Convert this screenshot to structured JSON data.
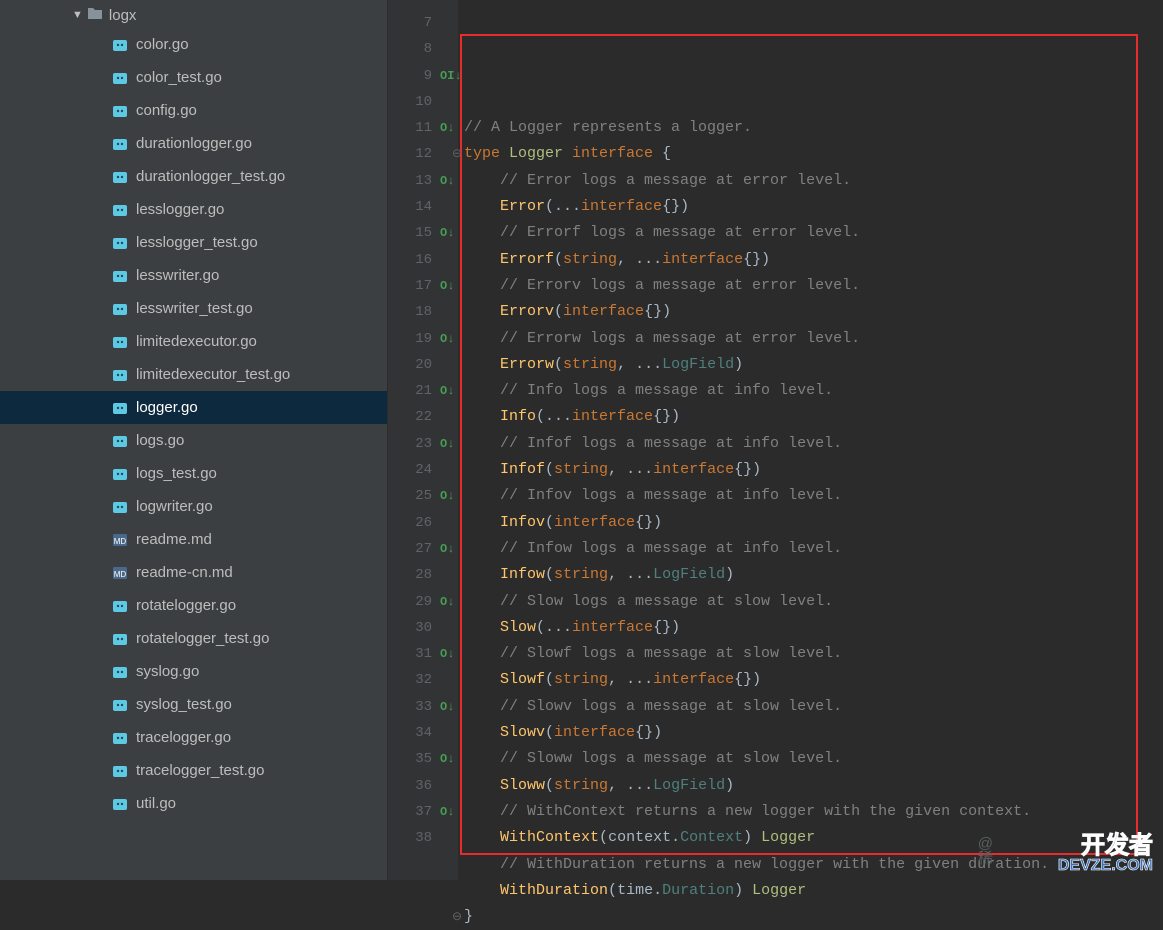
{
  "sidebar": {
    "folder": {
      "name": "logx"
    },
    "files": [
      {
        "name": "color.go",
        "icon": "go"
      },
      {
        "name": "color_test.go",
        "icon": "go"
      },
      {
        "name": "config.go",
        "icon": "go"
      },
      {
        "name": "durationlogger.go",
        "icon": "go"
      },
      {
        "name": "durationlogger_test.go",
        "icon": "go"
      },
      {
        "name": "lesslogger.go",
        "icon": "go"
      },
      {
        "name": "lesslogger_test.go",
        "icon": "go"
      },
      {
        "name": "lesswriter.go",
        "icon": "go"
      },
      {
        "name": "lesswriter_test.go",
        "icon": "go"
      },
      {
        "name": "limitedexecutor.go",
        "icon": "go"
      },
      {
        "name": "limitedexecutor_test.go",
        "icon": "go"
      },
      {
        "name": "logger.go",
        "icon": "go",
        "selected": true
      },
      {
        "name": "logs.go",
        "icon": "go"
      },
      {
        "name": "logs_test.go",
        "icon": "go"
      },
      {
        "name": "logwriter.go",
        "icon": "go"
      },
      {
        "name": "readme.md",
        "icon": "md"
      },
      {
        "name": "readme-cn.md",
        "icon": "md"
      },
      {
        "name": "rotatelogger.go",
        "icon": "go"
      },
      {
        "name": "rotatelogger_test.go",
        "icon": "go"
      },
      {
        "name": "syslog.go",
        "icon": "go"
      },
      {
        "name": "syslog_test.go",
        "icon": "go"
      },
      {
        "name": "tracelogger.go",
        "icon": "go"
      },
      {
        "name": "tracelogger_test.go",
        "icon": "go"
      },
      {
        "name": "util.go",
        "icon": "go"
      }
    ]
  },
  "editor": {
    "gutter_start": 7,
    "lines": [
      {
        "n": 7,
        "mark": "",
        "tokens": []
      },
      {
        "n": 8,
        "mark": "",
        "tokens": [
          [
            "comment",
            "// A Logger represents a logger."
          ]
        ]
      },
      {
        "n": 9,
        "mark": "OI↓",
        "fold": true,
        "tokens": [
          [
            "keyword",
            "type "
          ],
          [
            "type",
            "Logger "
          ],
          [
            "keyword",
            "interface "
          ],
          [
            "brace",
            "{"
          ]
        ]
      },
      {
        "n": 10,
        "mark": "",
        "tokens": [
          [
            "indent",
            "    "
          ],
          [
            "comment",
            "// Error logs a message at error level."
          ]
        ]
      },
      {
        "n": 11,
        "mark": "O↓",
        "tokens": [
          [
            "indent",
            "    "
          ],
          [
            "func",
            "Error"
          ],
          [
            "brace",
            "(..."
          ],
          [
            "keyword",
            "interface"
          ],
          [
            "brace",
            "{})"
          ]
        ]
      },
      {
        "n": 12,
        "mark": "",
        "tokens": [
          [
            "indent",
            "    "
          ],
          [
            "comment",
            "// Errorf logs a message at error level."
          ]
        ]
      },
      {
        "n": 13,
        "mark": "O↓",
        "tokens": [
          [
            "indent",
            "    "
          ],
          [
            "func",
            "Errorf"
          ],
          [
            "brace",
            "("
          ],
          [
            "keyword",
            "string"
          ],
          [
            "ident",
            ", "
          ],
          [
            "brace",
            "..."
          ],
          [
            "keyword",
            "interface"
          ],
          [
            "brace",
            "{})"
          ]
        ]
      },
      {
        "n": 14,
        "mark": "",
        "tokens": [
          [
            "indent",
            "    "
          ],
          [
            "comment",
            "// Errorv logs a message at error level."
          ]
        ]
      },
      {
        "n": 15,
        "mark": "O↓",
        "tokens": [
          [
            "indent",
            "    "
          ],
          [
            "func",
            "Errorv"
          ],
          [
            "brace",
            "("
          ],
          [
            "keyword",
            "interface"
          ],
          [
            "brace",
            "{})"
          ]
        ]
      },
      {
        "n": 16,
        "mark": "",
        "tokens": [
          [
            "indent",
            "    "
          ],
          [
            "comment",
            "// Errorw logs a message at error level."
          ]
        ]
      },
      {
        "n": 17,
        "mark": "O↓",
        "tokens": [
          [
            "indent",
            "    "
          ],
          [
            "func",
            "Errorw"
          ],
          [
            "brace",
            "("
          ],
          [
            "keyword",
            "string"
          ],
          [
            "ident",
            ", "
          ],
          [
            "brace",
            "..."
          ],
          [
            "lf",
            "LogField"
          ],
          [
            "brace",
            ")"
          ]
        ]
      },
      {
        "n": 18,
        "mark": "",
        "tokens": [
          [
            "indent",
            "    "
          ],
          [
            "comment",
            "// Info logs a message at info level."
          ]
        ]
      },
      {
        "n": 19,
        "mark": "O↓",
        "tokens": [
          [
            "indent",
            "    "
          ],
          [
            "func",
            "Info"
          ],
          [
            "brace",
            "(..."
          ],
          [
            "keyword",
            "interface"
          ],
          [
            "brace",
            "{})"
          ]
        ]
      },
      {
        "n": 20,
        "mark": "",
        "tokens": [
          [
            "indent",
            "    "
          ],
          [
            "comment",
            "// Infof logs a message at info level."
          ]
        ]
      },
      {
        "n": 21,
        "mark": "O↓",
        "tokens": [
          [
            "indent",
            "    "
          ],
          [
            "func",
            "Infof"
          ],
          [
            "brace",
            "("
          ],
          [
            "keyword",
            "string"
          ],
          [
            "ident",
            ", "
          ],
          [
            "brace",
            "..."
          ],
          [
            "keyword",
            "interface"
          ],
          [
            "brace",
            "{})"
          ]
        ]
      },
      {
        "n": 22,
        "mark": "",
        "tokens": [
          [
            "indent",
            "    "
          ],
          [
            "comment",
            "// Infov logs a message at info level."
          ]
        ]
      },
      {
        "n": 23,
        "mark": "O↓",
        "tokens": [
          [
            "indent",
            "    "
          ],
          [
            "func",
            "Infov"
          ],
          [
            "brace",
            "("
          ],
          [
            "keyword",
            "interface"
          ],
          [
            "brace",
            "{})"
          ]
        ]
      },
      {
        "n": 24,
        "mark": "",
        "tokens": [
          [
            "indent",
            "    "
          ],
          [
            "comment",
            "// Infow logs a message at info level."
          ]
        ]
      },
      {
        "n": 25,
        "mark": "O↓",
        "tokens": [
          [
            "indent",
            "    "
          ],
          [
            "func",
            "Infow"
          ],
          [
            "brace",
            "("
          ],
          [
            "keyword",
            "string"
          ],
          [
            "ident",
            ", "
          ],
          [
            "brace",
            "..."
          ],
          [
            "lf",
            "LogField"
          ],
          [
            "brace",
            ")"
          ]
        ]
      },
      {
        "n": 26,
        "mark": "",
        "tokens": [
          [
            "indent",
            "    "
          ],
          [
            "comment",
            "// Slow logs a message at slow level."
          ]
        ]
      },
      {
        "n": 27,
        "mark": "O↓",
        "tokens": [
          [
            "indent",
            "    "
          ],
          [
            "func",
            "Slow"
          ],
          [
            "brace",
            "(..."
          ],
          [
            "keyword",
            "interface"
          ],
          [
            "brace",
            "{})"
          ]
        ]
      },
      {
        "n": 28,
        "mark": "",
        "tokens": [
          [
            "indent",
            "    "
          ],
          [
            "comment",
            "// Slowf logs a message at slow level."
          ]
        ]
      },
      {
        "n": 29,
        "mark": "O↓",
        "tokens": [
          [
            "indent",
            "    "
          ],
          [
            "func",
            "Slowf"
          ],
          [
            "brace",
            "("
          ],
          [
            "keyword",
            "string"
          ],
          [
            "ident",
            ", "
          ],
          [
            "brace",
            "..."
          ],
          [
            "keyword",
            "interface"
          ],
          [
            "brace",
            "{})"
          ]
        ]
      },
      {
        "n": 30,
        "mark": "",
        "tokens": [
          [
            "indent",
            "    "
          ],
          [
            "comment",
            "// Slowv logs a message at slow level."
          ]
        ]
      },
      {
        "n": 31,
        "mark": "O↓",
        "tokens": [
          [
            "indent",
            "    "
          ],
          [
            "func",
            "Slowv"
          ],
          [
            "brace",
            "("
          ],
          [
            "keyword",
            "interface"
          ],
          [
            "brace",
            "{})"
          ]
        ]
      },
      {
        "n": 32,
        "mark": "",
        "tokens": [
          [
            "indent",
            "    "
          ],
          [
            "comment",
            "// Sloww logs a message at slow level."
          ]
        ]
      },
      {
        "n": 33,
        "mark": "O↓",
        "tokens": [
          [
            "indent",
            "    "
          ],
          [
            "func",
            "Sloww"
          ],
          [
            "brace",
            "("
          ],
          [
            "keyword",
            "string"
          ],
          [
            "ident",
            ", "
          ],
          [
            "brace",
            "..."
          ],
          [
            "lf",
            "LogField"
          ],
          [
            "brace",
            ")"
          ]
        ]
      },
      {
        "n": 34,
        "mark": "",
        "tokens": [
          [
            "indent",
            "    "
          ],
          [
            "comment",
            "// WithContext returns a new logger with the given context."
          ]
        ]
      },
      {
        "n": 35,
        "mark": "O↓",
        "tokens": [
          [
            "indent",
            "    "
          ],
          [
            "func",
            "WithContext"
          ],
          [
            "brace",
            "("
          ],
          [
            "ident",
            "context."
          ],
          [
            "lf",
            "Context"
          ],
          [
            "brace",
            ") "
          ],
          [
            "type",
            "Logger"
          ]
        ]
      },
      {
        "n": 36,
        "mark": "",
        "tokens": [
          [
            "indent",
            "    "
          ],
          [
            "comment",
            "// WithDuration returns a new logger with the given duration."
          ]
        ]
      },
      {
        "n": 37,
        "mark": "O↓",
        "tokens": [
          [
            "indent",
            "    "
          ],
          [
            "func",
            "WithDuration"
          ],
          [
            "brace",
            "("
          ],
          [
            "ident",
            "time."
          ],
          [
            "lf",
            "Duration"
          ],
          [
            "brace",
            ") "
          ],
          [
            "type",
            "Logger"
          ]
        ]
      },
      {
        "n": 38,
        "mark": "",
        "foldend": true,
        "tokens": [
          [
            "brace",
            "}"
          ]
        ]
      }
    ]
  },
  "watermark": {
    "l1": "开发者",
    "l2": "DEVZE.COM",
    "faint": "@稀"
  }
}
